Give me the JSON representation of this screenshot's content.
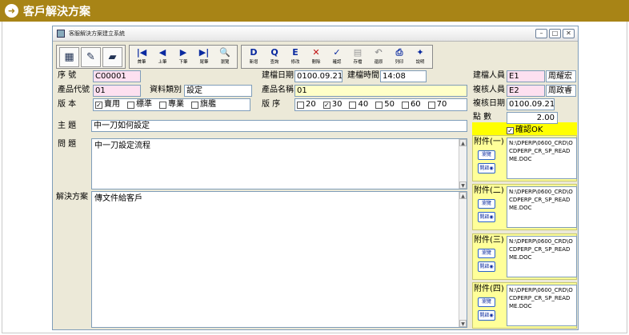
{
  "banner": {
    "title": "客戶解決方案",
    "icon": "arrow-right-circle-icon"
  },
  "window": {
    "title": "客服解決方案建立系統"
  },
  "toolbar": {
    "nav": [
      {
        "label": "首筆",
        "glyph": "|◀",
        "icon": "first-record-icon"
      },
      {
        "label": "上筆",
        "glyph": "◀",
        "icon": "prev-record-icon"
      },
      {
        "label": "下筆",
        "glyph": "▶",
        "icon": "next-record-icon"
      },
      {
        "label": "尾筆",
        "glyph": "▶|",
        "icon": "last-record-icon"
      },
      {
        "label": "瀏覽",
        "glyph": "🔍",
        "icon": "browse-icon"
      }
    ],
    "actions": [
      {
        "label": "新增",
        "glyph": "D",
        "icon": "new-record-icon"
      },
      {
        "label": "查詢",
        "glyph": "Q",
        "icon": "query-icon"
      },
      {
        "label": "修改",
        "glyph": "E",
        "icon": "edit-icon"
      },
      {
        "label": "刪除",
        "glyph": "✕",
        "icon": "delete-icon"
      },
      {
        "label": "確認",
        "glyph": "✓",
        "icon": "confirm-icon"
      },
      {
        "label": "存檔",
        "glyph": "▤",
        "icon": "save-icon"
      },
      {
        "label": "還原",
        "glyph": "↶",
        "icon": "undo-icon"
      },
      {
        "label": "列印",
        "glyph": "⎙",
        "icon": "print-icon"
      },
      {
        "label": "說明",
        "glyph": "✦",
        "icon": "help-icon"
      }
    ]
  },
  "form": {
    "seq_label": "序  號",
    "seq_value": "C00001",
    "prod_code_label": "產品代號",
    "prod_code_value": "01",
    "data_type_label": "資料類別",
    "data_type_value": "設定",
    "version_label": "版  本",
    "versions": [
      {
        "label": "賣用",
        "checked": true
      },
      {
        "label": "標準",
        "checked": false
      },
      {
        "label": "專業",
        "checked": false
      },
      {
        "label": "旗艦",
        "checked": false
      }
    ],
    "build_date_label": "建檔日期",
    "build_date_value": "0100.09.21",
    "build_time_label": "建檔時間",
    "build_time_value": "14:08",
    "prod_name_label": "產品名稱",
    "prod_name_value": "01",
    "order_label": "版  序",
    "orders": [
      {
        "label": "20",
        "checked": false
      },
      {
        "label": "30",
        "checked": true
      },
      {
        "label": "40",
        "checked": false
      },
      {
        "label": "50",
        "checked": false
      },
      {
        "label": "60",
        "checked": false
      },
      {
        "label": "70",
        "checked": false
      }
    ],
    "subject_label": "主  題",
    "subject_value": "中一刀如何設定",
    "question_label": "問  題",
    "question_value": "中一刀設定流程",
    "solution_label": "解決方案",
    "solution_value": "傳文件給客戶"
  },
  "right": {
    "creator_label": "建檔人員",
    "creator_code": "E1",
    "creator_name": "周耀宏",
    "reviewer_label": "複核人員",
    "reviewer_code": "E2",
    "reviewer_name": "周政睿",
    "review_date_label": "複核日期",
    "review_date_value": "0100.09.21",
    "points_label": "點  數",
    "points_value": "2.00",
    "confirm_label": "確認OK",
    "attachments": [
      {
        "label": "附件(一)",
        "browse": "瀏覽",
        "open": "開啟",
        "path": "N:\\DPERP\\0600_CRD\\OCDPERP_CR_SP_README.DOC"
      },
      {
        "label": "附件(二)",
        "browse": "瀏覽",
        "open": "開啟",
        "path": "N:\\DPERP\\0600_CRD\\OCDPERP_CR_SP_README.DOC"
      },
      {
        "label": "附件(三)",
        "browse": "瀏覽",
        "open": "開啟",
        "path": "N:\\DPERP\\0600_CRD\\OCDPERP_CR_SP_README.DOC"
      },
      {
        "label": "附件(四)",
        "browse": "瀏覽",
        "open": "開啟",
        "path": "N:\\DPERP\\0600_CRD\\OCDPERP_CR_SP_README.DOC"
      }
    ]
  }
}
